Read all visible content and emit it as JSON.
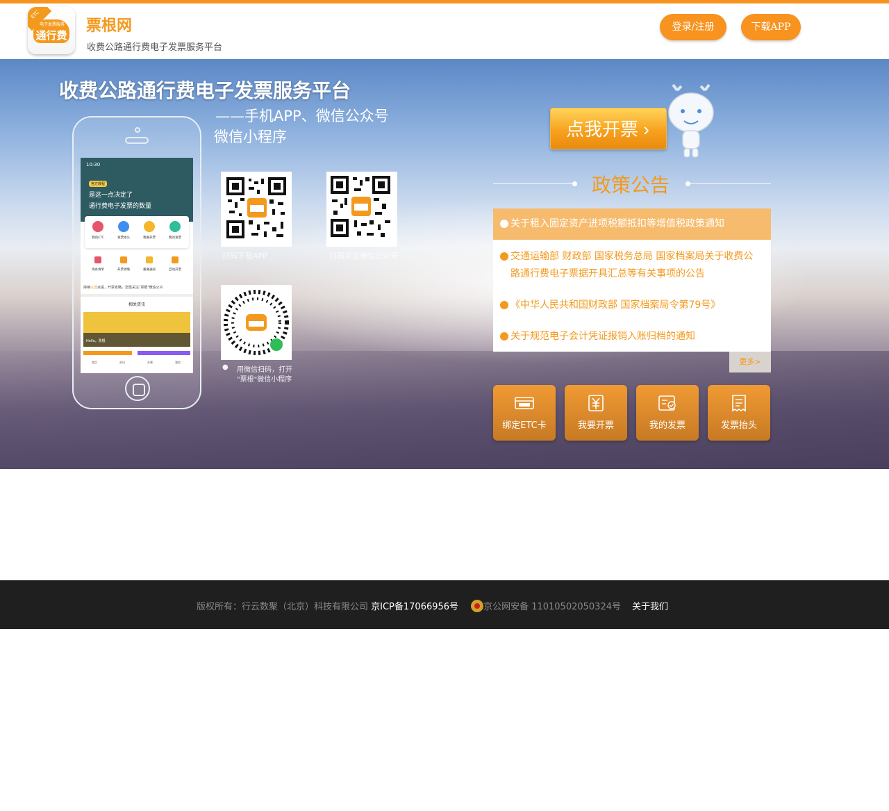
{
  "header": {
    "logo": {
      "corner": "ETC",
      "cloud_sub": "电子发票服务",
      "cloud_text": "通行费"
    },
    "brand_name": "票根网",
    "brand_sub": "收费公路通行费电子发票服务平台",
    "login_label": "登录/注册",
    "download_label": "下载APP",
    "accent": "#f7931e"
  },
  "banner": {
    "title": "收费公路通行费电子发票服务平台",
    "subtitle1": "——手机APP、微信公众号",
    "subtitle2": "微信小程序",
    "phone_screen": {
      "time": "10:30",
      "tag": "官方教程",
      "headline1": "是这一点决定了",
      "headline2": "通行费电子发票的数量",
      "icons": [
        "我的ETC",
        "发票抬头",
        "我要开票",
        "我的发票"
      ],
      "icons2": [
        "待办清单",
        "开票攻略",
        "重要通知",
        "自动开票"
      ],
      "note_prefix": "持续",
      "note_orange": "以选",
      "note_rest": "点说，开票攻略，您需关注\"票根\"微信公众",
      "section": "相关资讯",
      "image_text": "Hello，票根",
      "tabs": [
        "首页",
        "资讯",
        "开票",
        "我的"
      ]
    },
    "qr": {
      "app_caption": "扫码下载APP",
      "wechat_caption": "扫码关注微信公众号",
      "mini_caption_line1": "用微信扫码，打开",
      "mini_caption_line2": "\"票根\"微信小程序"
    },
    "invoice_button": "点我开票 ›",
    "policy_title": "政策公告",
    "policies": [
      "关于租入固定资产进项税额抵扣等增值税政策通知",
      "交通运输部 财政部 国家税务总局 国家档案局关于收费公路通行费电子票据开具汇总等有关事项的公告",
      "《中华人民共和国财政部 国家档案局令第79号》",
      "关于规范电子会计凭证报销入账归档的通知"
    ],
    "more_label": "更多>",
    "actions": [
      {
        "label": "绑定ETC卡",
        "icon": "etc-card-icon"
      },
      {
        "label": "我要开票",
        "icon": "yuan-icon"
      },
      {
        "label": "我的发票",
        "icon": "invoice-check-icon"
      },
      {
        "label": "发票抬头",
        "icon": "invoice-header-icon"
      }
    ]
  },
  "footer": {
    "copyright": "版权所有：行云数聚（北京）科技有限公司 ",
    "icp": "京ICP备17066956号",
    "police": "京公网安备 11010502050324号",
    "about": "关于我们"
  }
}
